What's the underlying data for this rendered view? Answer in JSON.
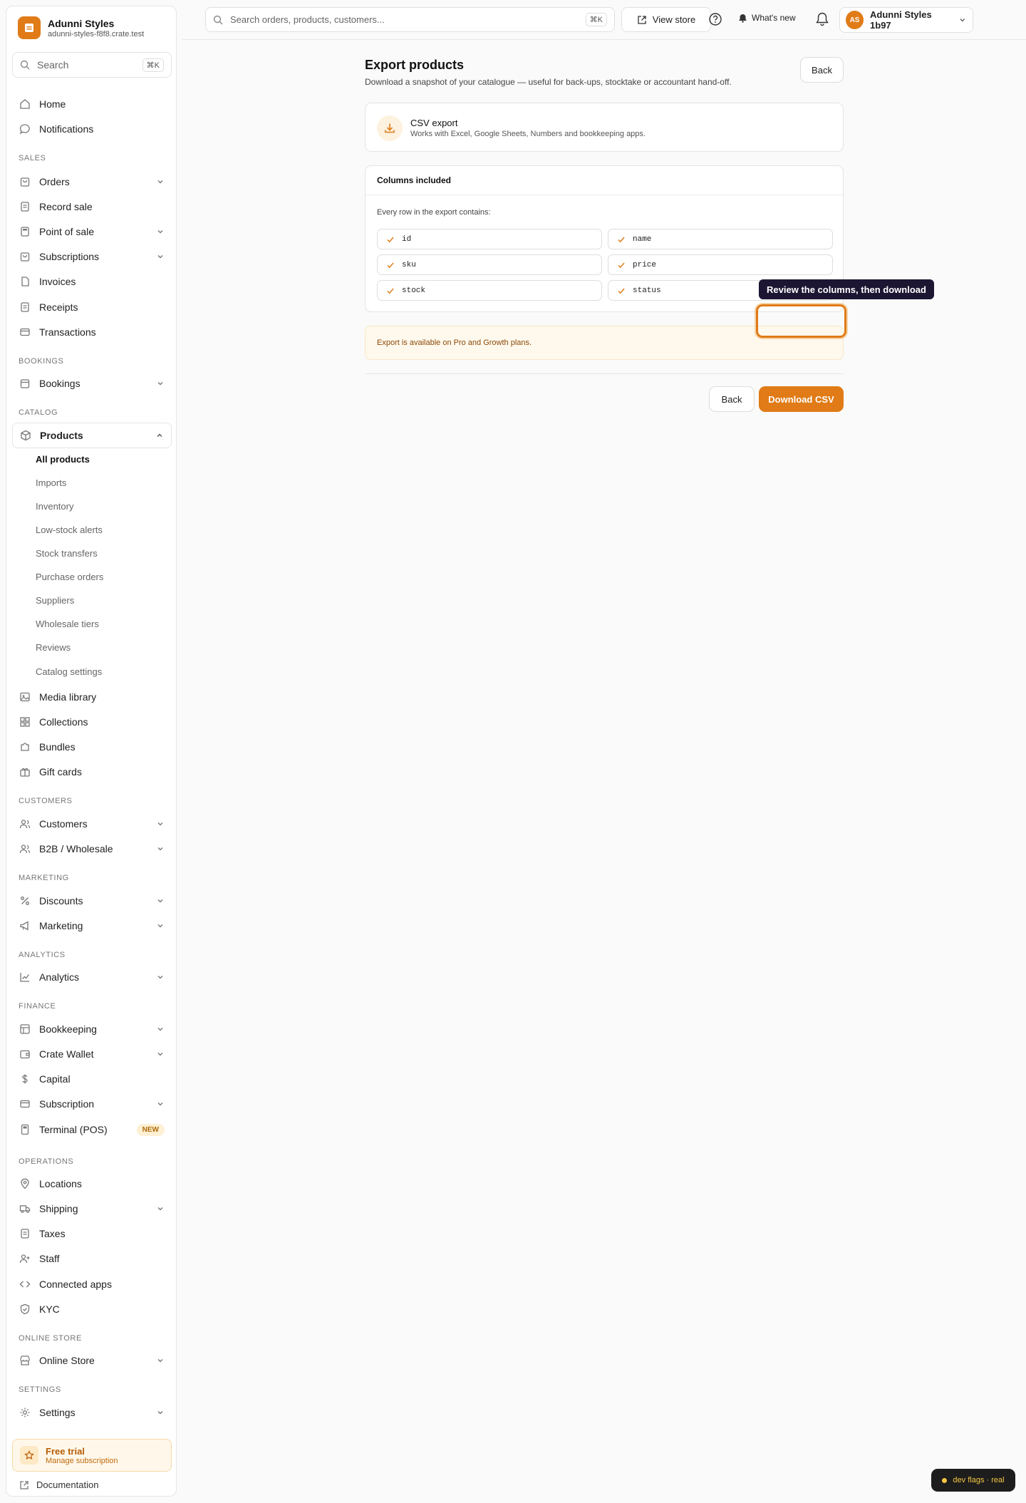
{
  "brand": {
    "name": "Adunni Styles",
    "domain": "adunni-styles-f8f8.crate.test"
  },
  "sidebar": {
    "search_placeholder": "Search",
    "search_shortcut": "⌘K",
    "items": {
      "home": "Home",
      "notifications": "Notifications",
      "orders": "Orders",
      "record_sale": "Record sale",
      "point_of_sale": "Point of sale",
      "subscriptions": "Subscriptions",
      "invoices": "Invoices",
      "receipts": "Receipts",
      "transactions": "Transactions",
      "bookings": "Bookings",
      "products": "Products",
      "media_library": "Media library",
      "collections": "Collections",
      "bundles": "Bundles",
      "gift_cards": "Gift cards",
      "customers": "Customers",
      "b2b": "B2B / Wholesale",
      "discounts": "Discounts",
      "marketing": "Marketing",
      "analytics": "Analytics",
      "bookkeeping": "Bookkeeping",
      "crate_wallet": "Crate Wallet",
      "capital": "Capital",
      "subscription": "Subscription",
      "terminal": "Terminal (POS)",
      "locations": "Locations",
      "shipping": "Shipping",
      "taxes": "Taxes",
      "staff": "Staff",
      "connected_apps": "Connected apps",
      "kyc": "KYC",
      "online_store": "Online Store",
      "settings": "Settings"
    },
    "terminal_badge": "NEW",
    "sections": {
      "sales": "SALES",
      "bookings": "BOOKINGS",
      "catalog": "CATALOG",
      "customers": "CUSTOMERS",
      "marketing": "MARKETING",
      "analytics": "ANALYTICS",
      "finance": "FINANCE",
      "operations": "OPERATIONS",
      "online_store": "ONLINE STORE",
      "settings": "SETTINGS"
    },
    "product_subitems": [
      "All products",
      "Imports",
      "Inventory",
      "Low-stock alerts",
      "Stock transfers",
      "Purchase orders",
      "Suppliers",
      "Wholesale tiers",
      "Reviews",
      "Catalog settings"
    ],
    "trial": {
      "title": "Free trial",
      "subtitle": "Manage subscription"
    },
    "documentation": "Documentation"
  },
  "topbar": {
    "search_placeholder": "Search orders, products, customers...",
    "search_shortcut": "⌘K",
    "view_store": "View store",
    "whats_new": "What's new",
    "account_initials": "AS",
    "account_name": "Adunni Styles 1b97"
  },
  "page": {
    "title": "Export products",
    "subtitle": "Download a snapshot of your catalogue — useful for back-ups, stocktake or accountant hand-off.",
    "back": "Back",
    "csv_title": "CSV export",
    "csv_subtitle": "Works with Excel, Google Sheets, Numbers and bookkeeping apps.",
    "columns_heading": "Columns included",
    "columns_intro": "Every row in the export contains:",
    "columns": [
      "id",
      "name",
      "sku",
      "price",
      "stock",
      "status"
    ],
    "notice": "Export is available on Pro and Growth plans.",
    "back_bottom": "Back",
    "download": "Download CSV"
  },
  "tooltip": "Review the columns, then download",
  "devflags": "dev flags · real",
  "colors": {
    "accent": "#e07b17",
    "tooltip_bg": "#1c1633"
  }
}
